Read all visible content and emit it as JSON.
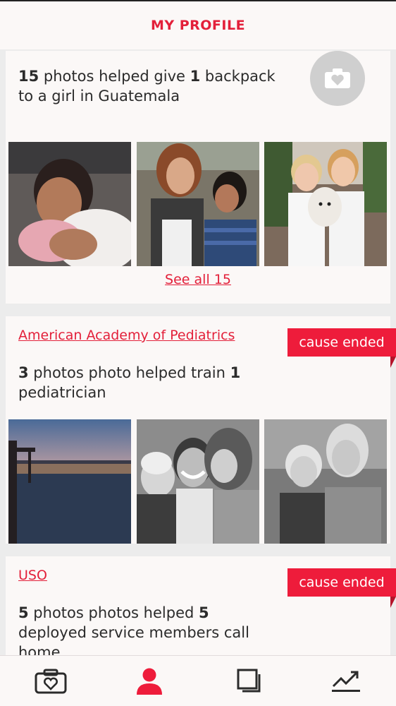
{
  "header": {
    "title": "MY PROFILE"
  },
  "cards": [
    {
      "impact": {
        "count": "15",
        "text_a": " photos helped give ",
        "qty": "1",
        "text_b": " backpack to a girl in Guatemala"
      },
      "see_all": "See all 15"
    },
    {
      "org": "American Academy of Pediatrics",
      "badge": "cause ended",
      "impact": {
        "count": "3",
        "text_a": " photos photo helped train ",
        "qty": "1",
        "text_b": " pediatrician"
      }
    },
    {
      "org": "USO",
      "badge": "cause ended",
      "impact": {
        "count": "5",
        "text_a": " photos photos helped ",
        "qty": "5",
        "text_b": " deployed service members call home"
      }
    }
  ],
  "nav": {
    "items": [
      {
        "icon": "camera-heart-icon"
      },
      {
        "icon": "profile-icon",
        "active": true
      },
      {
        "icon": "gallery-icon"
      },
      {
        "icon": "stats-icon"
      }
    ]
  },
  "colors": {
    "accent": "#e3203a",
    "badge": "#ee1c3b",
    "background": "#fbf8f7"
  }
}
